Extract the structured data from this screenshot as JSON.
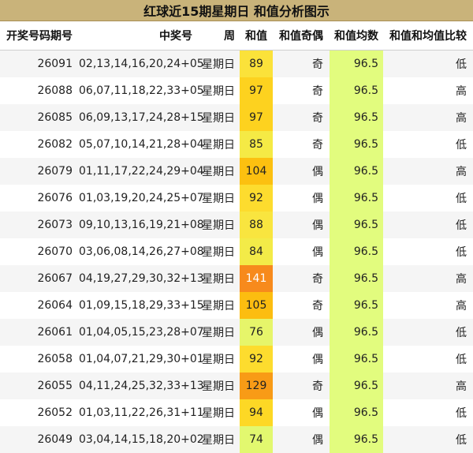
{
  "title": "红球近15期星期日 和值分析图示",
  "headers": [
    "开奖号码期号",
    "中奖号",
    "周",
    "和值",
    "和值奇偶",
    "和值均数",
    "和值和均值比较"
  ],
  "rows": [
    {
      "issue": "26091",
      "numbers": "02,13,14,16,20,24+05",
      "weekday": "星期日",
      "sum": "89",
      "parity": "奇",
      "avg": "96.5",
      "compare": "低",
      "sum_color": "#fbe23a",
      "sum_text_color": "#222222"
    },
    {
      "issue": "26088",
      "numbers": "06,07,11,18,22,33+05",
      "weekday": "星期日",
      "sum": "97",
      "parity": "奇",
      "avg": "96.5",
      "compare": "高",
      "sum_color": "#fdd21f",
      "sum_text_color": "#222222"
    },
    {
      "issue": "26085",
      "numbers": "06,09,13,17,24,28+15",
      "weekday": "星期日",
      "sum": "97",
      "parity": "奇",
      "avg": "96.5",
      "compare": "高",
      "sum_color": "#fdd21f",
      "sum_text_color": "#222222"
    },
    {
      "issue": "26082",
      "numbers": "05,07,10,14,21,28+04",
      "weekday": "星期日",
      "sum": "85",
      "parity": "奇",
      "avg": "96.5",
      "compare": "低",
      "sum_color": "#f5ea45",
      "sum_text_color": "#222222"
    },
    {
      "issue": "26079",
      "numbers": "01,11,17,22,24,29+04",
      "weekday": "星期日",
      "sum": "104",
      "parity": "偶",
      "avg": "96.5",
      "compare": "高",
      "sum_color": "#fcc010",
      "sum_text_color": "#222222"
    },
    {
      "issue": "26076",
      "numbers": "01,03,19,20,24,25+07",
      "weekday": "星期日",
      "sum": "92",
      "parity": "偶",
      "avg": "96.5",
      "compare": "低",
      "sum_color": "#fddc2e",
      "sum_text_color": "#222222"
    },
    {
      "issue": "26073",
      "numbers": "09,10,13,16,19,21+08",
      "weekday": "星期日",
      "sum": "88",
      "parity": "偶",
      "avg": "96.5",
      "compare": "低",
      "sum_color": "#f9e53f",
      "sum_text_color": "#222222"
    },
    {
      "issue": "26070",
      "numbers": "03,06,08,14,26,27+08",
      "weekday": "星期日",
      "sum": "84",
      "parity": "偶",
      "avg": "96.5",
      "compare": "低",
      "sum_color": "#f3eb48",
      "sum_text_color": "#222222"
    },
    {
      "issue": "26067",
      "numbers": "04,19,27,29,30,32+13",
      "weekday": "星期日",
      "sum": "141",
      "parity": "奇",
      "avg": "96.5",
      "compare": "高",
      "sum_color": "#f78a1c",
      "sum_text_color": "#ffffff"
    },
    {
      "issue": "26064",
      "numbers": "01,09,15,18,29,33+15",
      "weekday": "星期日",
      "sum": "105",
      "parity": "奇",
      "avg": "96.5",
      "compare": "高",
      "sum_color": "#fcbd10",
      "sum_text_color": "#222222"
    },
    {
      "issue": "26061",
      "numbers": "01,04,05,15,23,28+07",
      "weekday": "星期日",
      "sum": "76",
      "parity": "偶",
      "avg": "96.5",
      "compare": "低",
      "sum_color": "#e6f56a",
      "sum_text_color": "#222222"
    },
    {
      "issue": "26058",
      "numbers": "01,04,07,21,29,30+01",
      "weekday": "星期日",
      "sum": "92",
      "parity": "偶",
      "avg": "96.5",
      "compare": "低",
      "sum_color": "#fddc2e",
      "sum_text_color": "#222222"
    },
    {
      "issue": "26055",
      "numbers": "04,11,24,25,32,33+13",
      "weekday": "星期日",
      "sum": "129",
      "parity": "奇",
      "avg": "96.5",
      "compare": "高",
      "sum_color": "#f89b16",
      "sum_text_color": "#222222"
    },
    {
      "issue": "26052",
      "numbers": "01,03,11,22,26,31+11",
      "weekday": "星期日",
      "sum": "94",
      "parity": "偶",
      "avg": "96.5",
      "compare": "低",
      "sum_color": "#fdd825",
      "sum_text_color": "#222222"
    },
    {
      "issue": "26049",
      "numbers": "03,04,14,15,18,20+02",
      "weekday": "星期日",
      "sum": "74",
      "parity": "偶",
      "avg": "96.5",
      "compare": "低",
      "sum_color": "#e2f86f",
      "sum_text_color": "#222222"
    }
  ],
  "colors": {
    "title_bg": "#c9b37a",
    "avg_bg": "#e2fc7e",
    "row_alt_bg": "#f5f5f5"
  }
}
